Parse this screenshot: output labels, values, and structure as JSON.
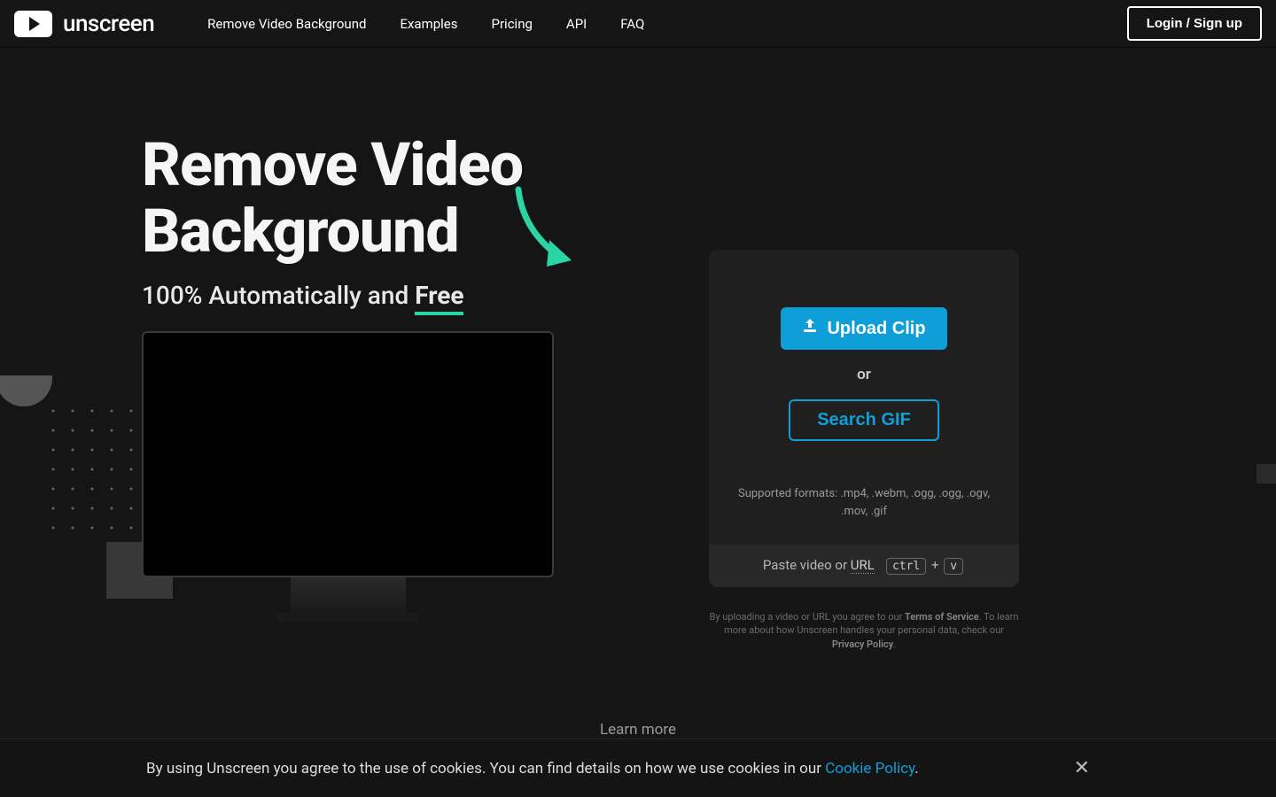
{
  "header": {
    "logo_text": "unscreen",
    "nav": [
      "Remove Video Background",
      "Examples",
      "Pricing",
      "API",
      "FAQ"
    ],
    "login_label": "Login / Sign up"
  },
  "hero": {
    "title_line1": "Remove Video",
    "title_line2": "Background",
    "subtitle_prefix": "100% Automatically and ",
    "subtitle_free": "Free"
  },
  "upload": {
    "upload_label": "Upload Clip",
    "or_label": "or",
    "search_gif_label": "Search GIF",
    "supported_formats": "Supported formats: .mp4, .webm, .ogg, .ogg, .ogv, .mov, .gif",
    "paste_prefix": "Paste video or ",
    "url_label": "URL",
    "kbd1": "ctrl",
    "plus": " + ",
    "kbd2": "v"
  },
  "legal": {
    "prefix": "By uploading a video or URL you agree to our ",
    "terms_label": "Terms of Service",
    "middle": ". To learn more about how Unscreen handles your personal data, check our ",
    "privacy_label": "Privacy Policy",
    "suffix": "."
  },
  "learn_more": {
    "label": "Learn more"
  },
  "cookie": {
    "text_prefix": "By using Unscreen you agree to the use of cookies. You can find details on how we use cookies in our ",
    "link_label": "Cookie Policy",
    "text_suffix": "."
  }
}
